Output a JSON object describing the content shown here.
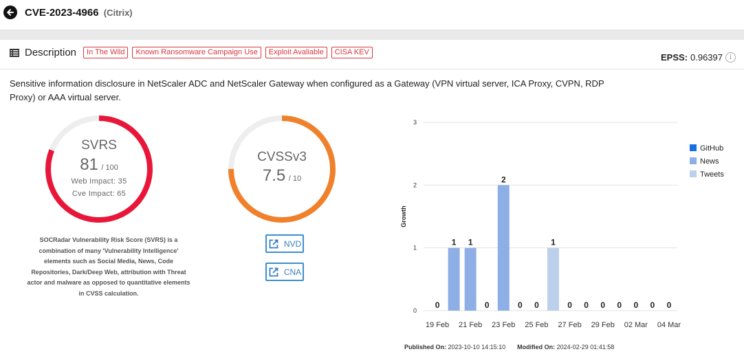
{
  "header": {
    "cve_id": "CVE-2023-4966",
    "vendor": "(Citrix)"
  },
  "description": {
    "label": "Description",
    "tags": [
      "In The Wild",
      "Known Ransomware Campaign Use",
      "Exploit Avaliable",
      "CISA KEV"
    ],
    "epss_label": "EPSS:",
    "epss_value": "0.96397",
    "text": "Sensitive information disclosure in NetScaler ADC and NetScaler Gateway when configured as a Gateway (VPN virtual server, ICA Proxy, CVPN, RDP Proxy) or AAA virtual server."
  },
  "svrs": {
    "title": "SVRS",
    "score": "81",
    "max": "/ 100",
    "score_value": 81,
    "max_value": 100,
    "web_impact": "Web Impact: 35",
    "cve_impact": "Cve Impact: 65",
    "color": "#e8173a",
    "explanation": "SOCRadar Vulnerability Risk Score (SVRS) is a combination of many 'Vulnerability Intelligence' elements such as Social Media, News, Code Repositories, Dark/Deep Web, attribution with Threat actor and malware as opposed to quantitative elements in CVSS calculation."
  },
  "cvss": {
    "title": "CVSSv3",
    "score": "7.5",
    "max": "/ 10",
    "score_value": 7.5,
    "max_value": 10,
    "color": "#f0802a",
    "buttons": [
      {
        "label": "NVD",
        "icon": "external-link-icon"
      },
      {
        "label": "CNA",
        "icon": "external-link-icon"
      }
    ]
  },
  "footer": {
    "published_label": "Published On:",
    "published_value": "2023-10-10 14:15:10",
    "modified_label": "Modified On:",
    "modified_value": "2024-02-29 01:41:58"
  },
  "chart_data": {
    "type": "bar",
    "ylabel": "Growth",
    "ylim": [
      0,
      3
    ],
    "yticks": [
      0,
      1,
      2,
      3
    ],
    "grid": true,
    "legend_position": "right",
    "x": [
      "19 Feb",
      "20 Feb",
      "21 Feb",
      "22 Feb",
      "23 Feb",
      "24 Feb",
      "25 Feb",
      "26 Feb",
      "27 Feb",
      "28 Feb",
      "29 Feb",
      "01 Mar",
      "02 Mar",
      "03 Mar",
      "04 Mar"
    ],
    "xtick_labels": [
      "19 Feb",
      "21 Feb",
      "23 Feb",
      "25 Feb",
      "27 Feb",
      "29 Feb",
      "02 Mar",
      "04 Mar"
    ],
    "series": [
      {
        "name": "GitHub",
        "color": "#1a6fe0",
        "values": [
          0,
          0,
          0,
          0,
          0,
          0,
          0,
          0,
          0,
          0,
          0,
          0,
          0,
          0,
          0
        ]
      },
      {
        "name": "News",
        "color": "#8eafe6",
        "values": [
          0,
          1,
          1,
          0,
          2,
          0,
          0,
          0,
          0,
          0,
          0,
          0,
          0,
          0,
          0
        ]
      },
      {
        "name": "Tweets",
        "color": "#bcd0ec",
        "values": [
          0,
          0,
          0,
          0,
          0,
          0,
          0,
          1,
          0,
          0,
          0,
          0,
          0,
          0,
          0
        ]
      }
    ],
    "totals": [
      0,
      1,
      1,
      0,
      2,
      0,
      0,
      1,
      0,
      0,
      0,
      0,
      0,
      0,
      0
    ]
  }
}
